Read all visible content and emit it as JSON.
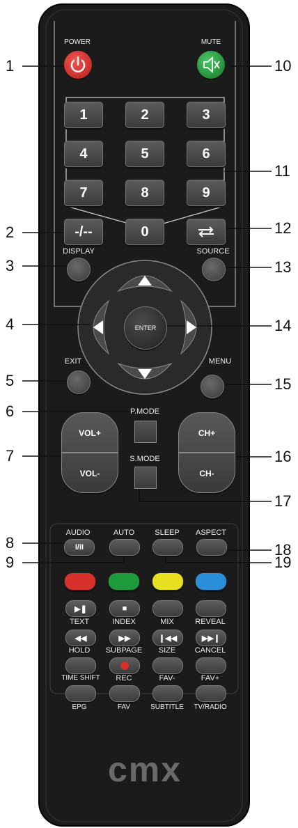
{
  "brand": "cmx",
  "buttons": {
    "power": "POWER",
    "mute": "MUTE",
    "digits": [
      "1",
      "2",
      "3",
      "4",
      "5",
      "6",
      "7",
      "8",
      "9"
    ],
    "zero": "0",
    "dash": "-/--",
    "display": "DISPLAY",
    "source": "SOURCE",
    "enter": "ENTER",
    "exit": "EXIT",
    "menu": "MENU",
    "pmode": "P.MODE",
    "smode": "S.MODE",
    "vol_up": "VOL+",
    "vol_down": "VOL-",
    "ch_up": "CH+",
    "ch_down": "CH-",
    "audio": "AUDIO",
    "audio_face": "I/II",
    "auto": "AUTO",
    "sleep": "SLEEP",
    "aspect": "ASPECT"
  },
  "color_keys": [
    "#d8302b",
    "#1f9a3a",
    "#e6e020",
    "#2a8ed8"
  ],
  "teletext": {
    "row1_top": [
      "TEXT",
      "INDEX",
      "MIX",
      "REVEAL"
    ],
    "row2_top": [
      "HOLD",
      "SUBPAGE",
      "SIZE",
      "CANCEL"
    ],
    "row3_top": [
      "TIME SHIFT",
      "REC",
      "FAV-",
      "FAV+"
    ],
    "row3_bottom": [
      "EPG",
      "FAV",
      "SUBTITLE",
      "TV/RADIO"
    ]
  },
  "callouts": {
    "left": [
      "1",
      "2",
      "3",
      "4",
      "5",
      "6",
      "7",
      "8",
      "9"
    ],
    "right": [
      "10",
      "11",
      "12",
      "13",
      "14",
      "15",
      "16",
      "17",
      "18",
      "19"
    ]
  },
  "colors": {
    "body": "#1a1a1a",
    "power": "#d8302b",
    "mute": "#1f9a3a",
    "rec_dot": "#d8302b"
  }
}
